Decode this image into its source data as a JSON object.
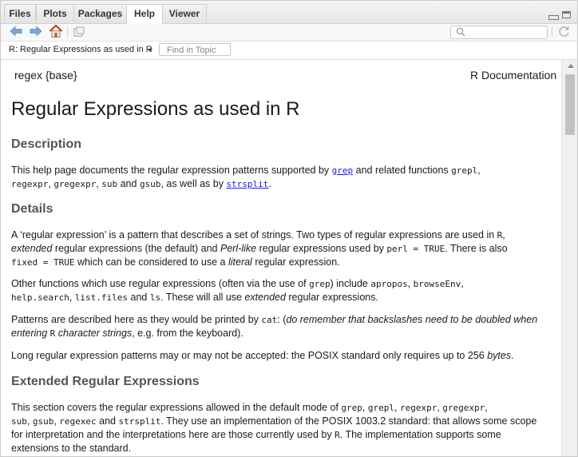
{
  "tabs": [
    "Files",
    "Plots",
    "Packages",
    "Help",
    "Viewer"
  ],
  "toolbar": {
    "icons": [
      "back-arrow-icon",
      "forward-arrow-icon",
      "home-icon",
      "popout-icon",
      "search-icon",
      "refresh-icon"
    ],
    "search_value": ""
  },
  "topicbar": {
    "topic": "R: Regular Expressions as used in R",
    "find_placeholder": "Find in Topic"
  },
  "doc": {
    "package": "regex {base}",
    "doc_label": "R Documentation",
    "title": "Regular Expressions as used in R",
    "description_heading": "Description",
    "description": {
      "t1": "This help page documents the regular expression patterns supported by ",
      "grep_link": "grep",
      "t2": " and related functions ",
      "grepl": "grepl",
      "comma1": ",",
      "regexpr": "regexpr",
      "comma2": ", ",
      "gregexpr": "gregexpr",
      "comma3": ", ",
      "sub": "sub",
      "and": " and ",
      "gsub": "gsub",
      "t3": ", as well as by ",
      "strsplit_link": "strsplit",
      "end": "."
    },
    "details_heading": "Details",
    "details_p1": {
      "t1": "A ‘regular expression’ is a pattern that describes a set of strings. Two types of regular expressions are used in ",
      "R": "R",
      "t2": ",",
      "extended": "extended",
      "t3": " regular expressions (the default) and ",
      "perl_like": "Perl-like",
      "t4": " regular expressions used by ",
      "perl_true": "perl = TRUE",
      "t5": ". There is also ",
      "fixed_true": "fixed = TRUE",
      "t6": " which can be considered to use a ",
      "literal": "literal",
      "t7": " regular expression."
    },
    "details_p2": {
      "t1": "Other functions which use regular expressions (often via the use of ",
      "grep": "grep",
      "t2": ") include ",
      "apropos": "apropos",
      "c1": ", ",
      "browseEnv": "browseEnv",
      "c2": ",",
      "help_search": "help.search",
      "c3": ", ",
      "list_files": "list.files",
      "and": " and ",
      "ls": "ls",
      "t3": ". These will all use ",
      "extended": "extended",
      "t4": " regular expressions."
    },
    "details_p3": {
      "t1": "Patterns are described here as they would be printed by ",
      "cat": "cat",
      "t2": ": (",
      "note1": "do remember that backslashes need to be doubled when entering ",
      "R": "R",
      "note2": " character strings",
      "t3": ", e.g. from the keyboard)."
    },
    "details_p4": {
      "t1": "Long regular expression patterns may or may not be accepted: the POSIX standard only requires up to 256 ",
      "bytes": "bytes",
      "end": "."
    },
    "extended_heading": "Extended Regular Expressions",
    "extended_p1": {
      "t1": "This section covers the regular expressions allowed in the default mode of ",
      "grep": "grep",
      "c1": ", ",
      "grepl": "grepl",
      "c2": ", ",
      "regexpr": "regexpr",
      "c3": ", ",
      "gregexpr": "gregexpr",
      "c4": ",",
      "sub": "sub",
      "c5": ", ",
      "gsub": "gsub",
      "c6": ", ",
      "regexec": "regexec",
      "and": " and ",
      "strsplit": "strsplit",
      "t2": ". They use an implementation of the POSIX 1003.2 standard: that allows some scope for interpretation and the interpretations here are those currently used by ",
      "R": "R",
      "t3": ". The implementation supports some extensions to the standard."
    }
  }
}
